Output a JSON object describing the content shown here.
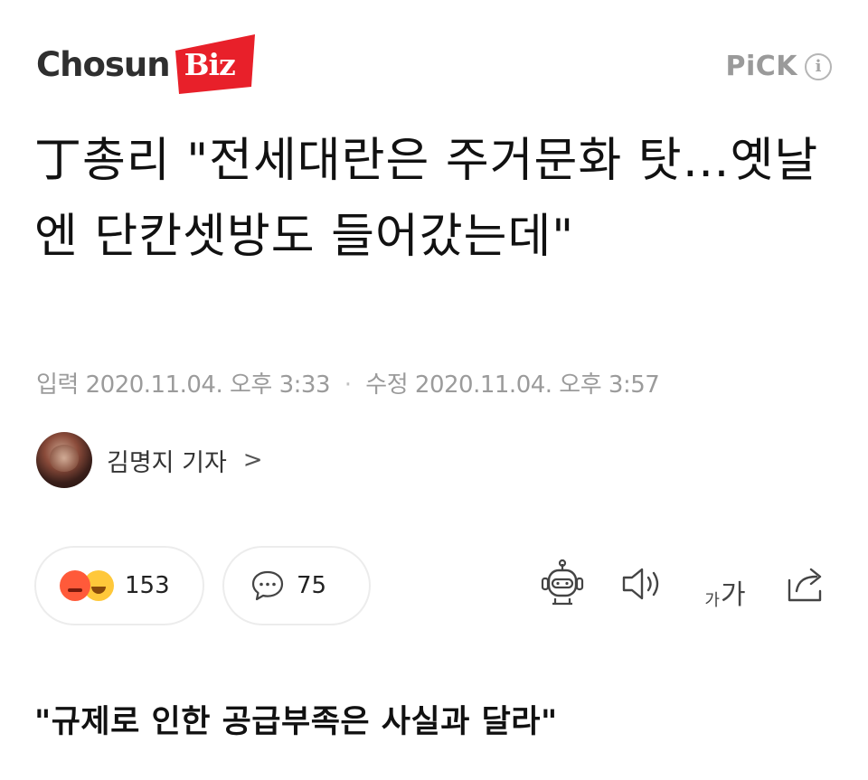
{
  "header": {
    "logo": {
      "chosun": "Chosun",
      "biz": "Biz",
      "brand_color": "#e8202a"
    },
    "pick_label": "PiCK",
    "info_icon": "info-icon"
  },
  "article": {
    "headline": "丁총리 \"전세대란은 주거문화 탓…옛날엔 단칸셋방도 들어갔는데\"",
    "meta": {
      "published_label": "입력",
      "published_date": "2020.11.04. 오후 3:33",
      "modified_label": "수정",
      "modified_date": "2020.11.04. 오후 3:57"
    },
    "reporter": {
      "name": "김명지 기자",
      "chevron": ">"
    },
    "reactions": {
      "icons": [
        "angry-emoji-icon",
        "laugh-emoji-icon"
      ],
      "count": "153"
    },
    "comments": {
      "icon": "speech-bubble-icon",
      "count": "75"
    },
    "tools": {
      "summary_bot": "robot-icon",
      "listen": "speaker-icon",
      "font_size": {
        "small": "가",
        "big": "가"
      },
      "share": "share-icon"
    },
    "subheadline": "\"규제로 인한 공급부족은 사실과 달라\""
  }
}
